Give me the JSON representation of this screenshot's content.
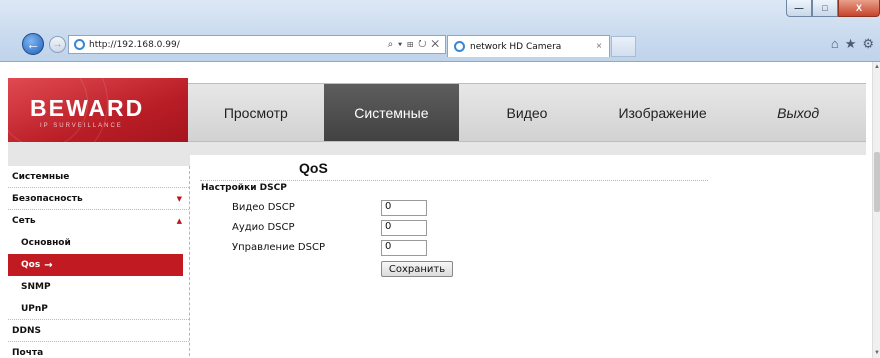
{
  "browser": {
    "url": "http://192.168.0.99/",
    "address_tools": "⌕ ▾ ⊞ ↻ ✕",
    "tab_title": "network HD Camera",
    "tab_close": "×",
    "window_buttons": {
      "minimize": "—",
      "maximize": "□",
      "close": "X"
    },
    "right_icons": {
      "home": "⌂",
      "favorites": "★",
      "settings": "⚙"
    }
  },
  "logo": {
    "brand": "BEWARD",
    "tagline": "IP SURVEILLANCE"
  },
  "topnav": {
    "items": [
      "Просмотр",
      "Системные",
      "Видео",
      "Изображение",
      "Выход"
    ],
    "active_index": 1
  },
  "sidebar": {
    "items": [
      {
        "label": "Системные",
        "level": 1
      },
      {
        "label": "Безопасность",
        "level": 1,
        "arrow": "▼"
      },
      {
        "label": "Сеть",
        "level": 1,
        "arrow": "▲"
      },
      {
        "label": "Основной",
        "level": 2
      },
      {
        "label": "Qos",
        "level": 2,
        "selected": true,
        "indicator": "→"
      },
      {
        "label": "SNMP",
        "level": 2
      },
      {
        "label": "UPnP",
        "level": 2
      },
      {
        "label": "DDNS",
        "level": 1
      },
      {
        "label": "Почта",
        "level": 1
      }
    ]
  },
  "content": {
    "title": "QoS",
    "section": "Настройки DSCP",
    "fields": [
      {
        "label": "Видео DSCP",
        "value": "0"
      },
      {
        "label": "Аудио DSCP",
        "value": "0"
      },
      {
        "label": "Управление DSCP",
        "value": "0"
      }
    ],
    "save_label": "Сохранить"
  },
  "colors": {
    "brand_red": "#c21a23",
    "nav_active": "#4a4a4a",
    "nav_bg": "#dcdcdc"
  }
}
